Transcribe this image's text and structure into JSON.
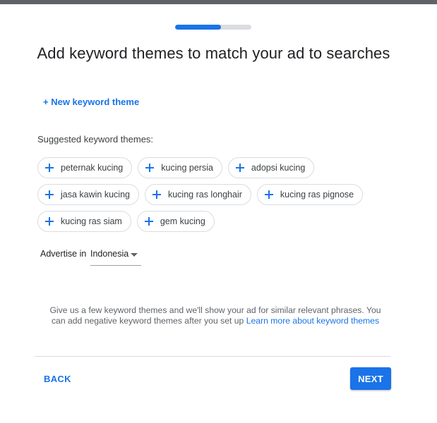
{
  "progress": {
    "percent": 60
  },
  "header": {
    "title": "Add keyword themes to match your ad to searches"
  },
  "new_theme_link": "+ New keyword theme",
  "suggested": {
    "label": "Suggested keyword themes:",
    "rows": [
      [
        "peternak kucing",
        "kucing persia",
        "adopsi kucing"
      ],
      [
        "jasa kawin kucing",
        "kucing ras longhair",
        "kucing ras pignose"
      ],
      [
        "kucing ras siam",
        "gem kucing"
      ]
    ]
  },
  "advertise": {
    "label": "Advertise in",
    "country": "Indonesia"
  },
  "help": {
    "text": "Give us a few keyword themes and we'll show your ad for similar relevant phrases. You can add negative keyword themes after you set up ",
    "link": "Learn more about keyword themes"
  },
  "footer": {
    "back_label": "BACK",
    "next_label": "NEXT"
  },
  "colors": {
    "accent": "#1a73e8",
    "track": "#dadce0",
    "topbar": "#5f6368"
  },
  "icons": {
    "chip_icon": "plus-icon",
    "select_icon": "caret-down-icon"
  }
}
